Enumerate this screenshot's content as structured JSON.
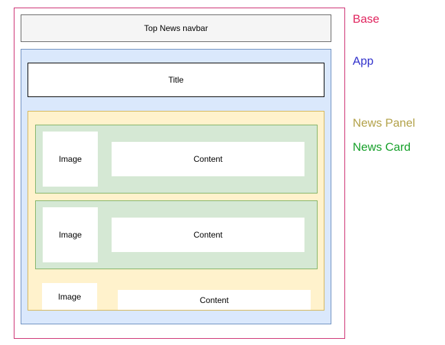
{
  "labels": {
    "navbar": "Top News navbar",
    "title": "Title",
    "image": "Image",
    "content": "Content"
  },
  "cards": [
    {
      "image": "Image",
      "content": "Content"
    },
    {
      "image": "Image",
      "content": "Content"
    },
    {
      "image": "Image",
      "content": "Content"
    }
  ],
  "legend": [
    {
      "label": "Base",
      "color": "#e0245e"
    },
    {
      "label": "App",
      "color": "#3333cc"
    },
    {
      "label": "News Panel",
      "color": "#b3a24a"
    },
    {
      "label": "News Card",
      "color": "#16a02a"
    }
  ]
}
